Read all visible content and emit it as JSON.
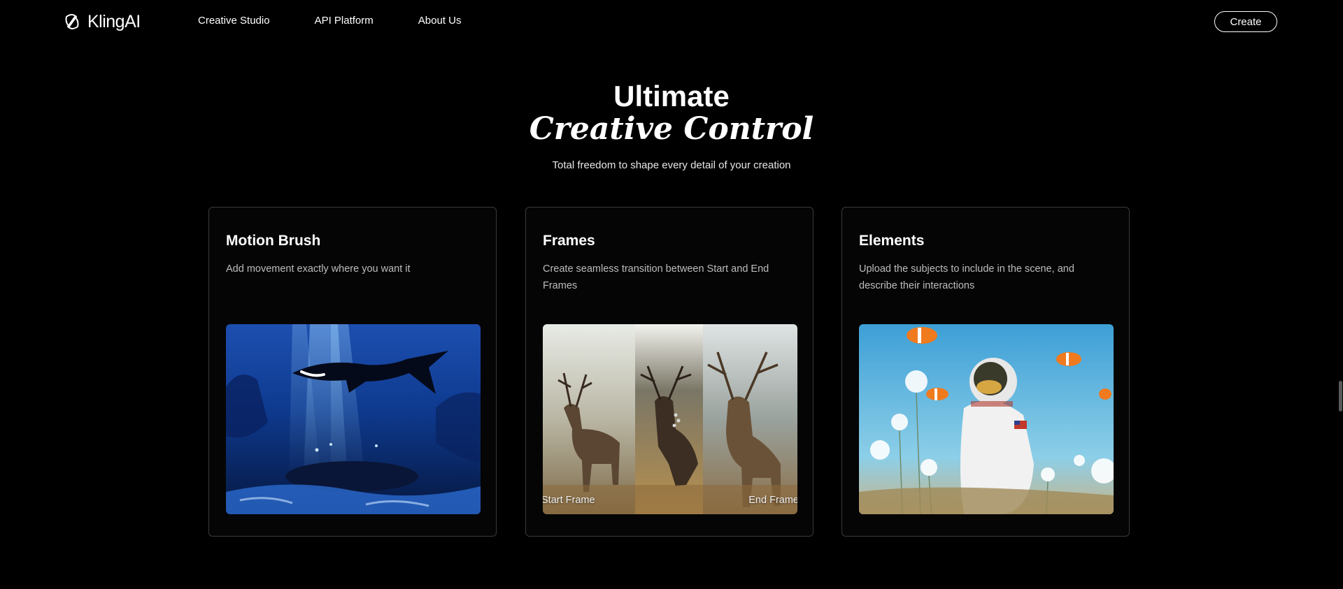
{
  "header": {
    "logo_text": "KlingAI",
    "nav": [
      "Creative Studio",
      "API Platform",
      "About Us"
    ],
    "create_label": "Create"
  },
  "hero": {
    "title_line1": "Ultimate",
    "title_line2": "Creative Control",
    "subtitle": "Total freedom to shape every detail of your creation"
  },
  "cards": [
    {
      "title": "Motion Brush",
      "description": "Add movement exactly where you want it",
      "image": "underwater-shark-image"
    },
    {
      "title": "Frames",
      "description": "Create seamless transition between Start and End Frames",
      "image": "deer-frames-image",
      "start_label": "Start Frame",
      "end_label": "End Frame"
    },
    {
      "title": "Elements",
      "description": "Upload the subjects to include in the scene, and describe their interactions",
      "image": "astronaut-fish-image"
    }
  ],
  "colors": {
    "background": "#000000",
    "card_border": "#3a3a3a",
    "muted_text": "#bdbdbd"
  }
}
